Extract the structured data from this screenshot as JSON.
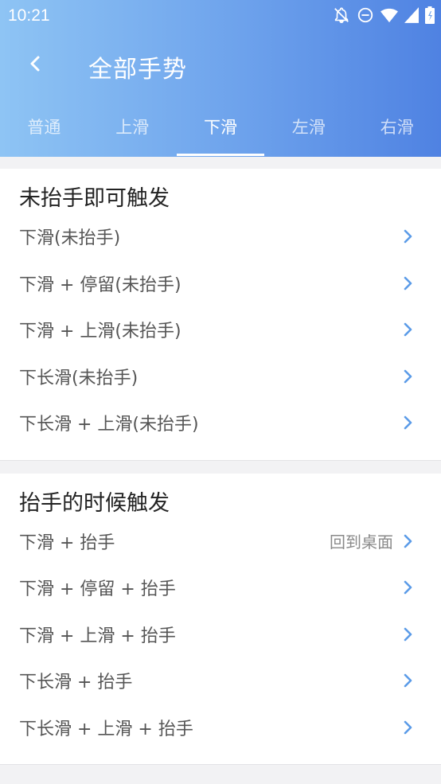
{
  "status": {
    "time": "10:21",
    "icons": [
      "notifications-off-icon",
      "do-not-disturb-icon",
      "wifi-icon",
      "signal-icon",
      "battery-icon"
    ]
  },
  "header": {
    "title": "全部手势",
    "back_icon": "chevron-left-icon",
    "tabs": [
      {
        "label": "普通",
        "active": false
      },
      {
        "label": "上滑",
        "active": false
      },
      {
        "label": "下滑",
        "active": true
      },
      {
        "label": "左滑",
        "active": false
      },
      {
        "label": "右滑",
        "active": false
      }
    ]
  },
  "sections": [
    {
      "title": "未抬手即可触发",
      "items": [
        {
          "label": "下滑(未抬手)",
          "value": ""
        },
        {
          "label": "下滑 + 停留(未抬手)",
          "value": ""
        },
        {
          "label": "下滑 + 上滑(未抬手)",
          "value": ""
        },
        {
          "label": "下长滑(未抬手)",
          "value": ""
        },
        {
          "label": "下长滑 + 上滑(未抬手)",
          "value": ""
        }
      ]
    },
    {
      "title": "抬手的时候触发",
      "items": [
        {
          "label": "下滑 + 抬手",
          "value": "回到桌面"
        },
        {
          "label": "下滑 + 停留 + 抬手",
          "value": ""
        },
        {
          "label": "下滑 + 上滑 + 抬手",
          "value": ""
        },
        {
          "label": "下长滑 + 抬手",
          "value": ""
        },
        {
          "label": "下长滑 + 上滑 + 抬手",
          "value": ""
        }
      ]
    }
  ],
  "colors": {
    "header_gradient_start": "#8ec4f4",
    "header_gradient_end": "#4f82e2",
    "chevron": "#5b9be8",
    "background": "#f2f2f4"
  }
}
